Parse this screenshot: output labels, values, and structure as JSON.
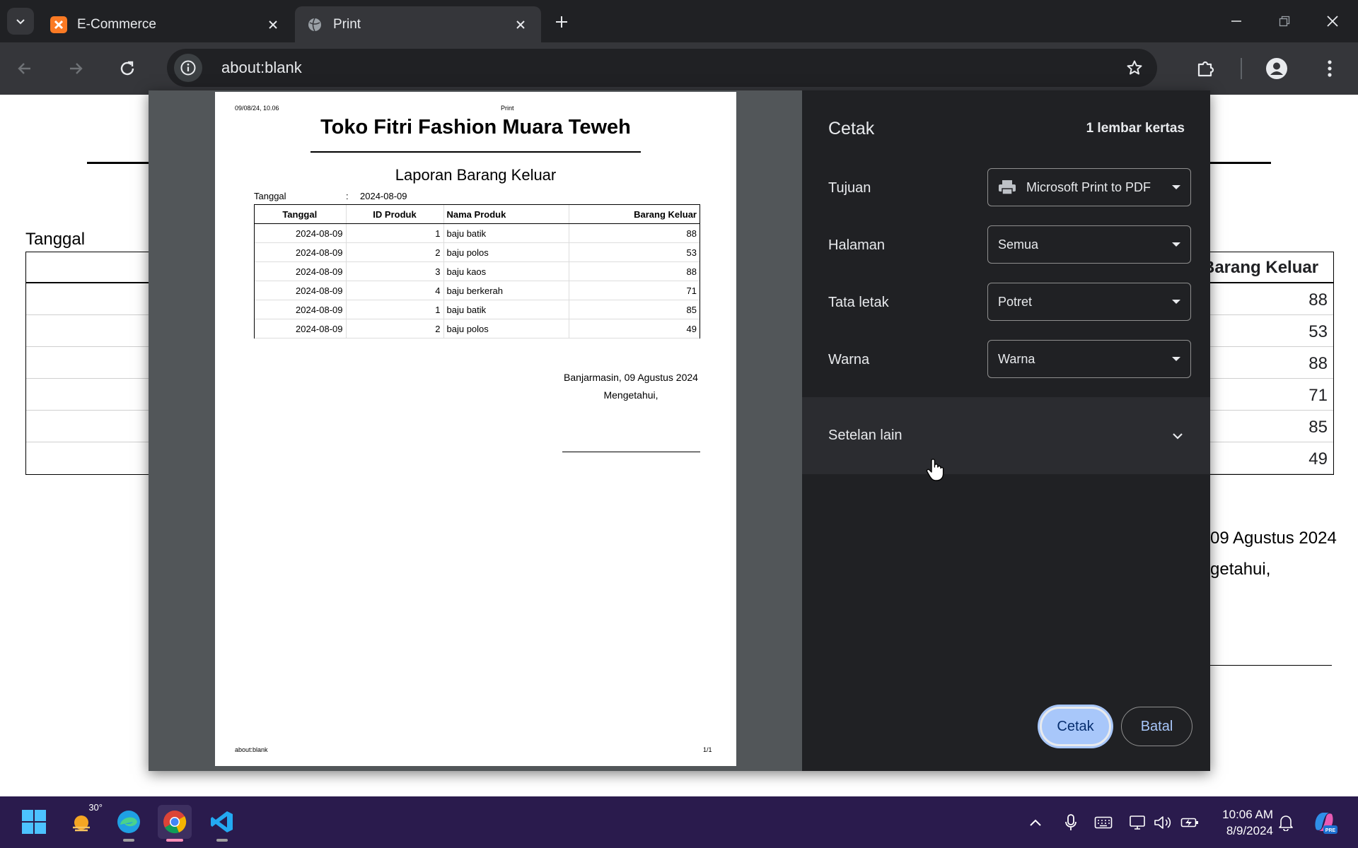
{
  "browser": {
    "tabs": [
      {
        "title": "E-Commerce",
        "active": false,
        "favicon": "xampp-icon"
      },
      {
        "title": "Print",
        "active": true,
        "favicon": "globe-icon"
      }
    ],
    "url": "about:blank"
  },
  "background_page": {
    "tanggal_label": "Tanggal",
    "column_header": "Barang Keluar",
    "values": [
      "88",
      "53",
      "88",
      "71",
      "85",
      "49"
    ],
    "place_date_fragment": "09 Agustus 2024",
    "mengetahui_fragment": "getahui,"
  },
  "preview": {
    "header_left": "09/08/24, 10.06",
    "header_center": "Print",
    "shop_name": "Toko Fitri Fashion Muara Teweh",
    "report_title": "Laporan Barang Keluar",
    "date_label": "Tanggal",
    "date_colon": ":",
    "date_value": "2024-08-09",
    "columns": [
      "Tanggal",
      "ID Produk",
      "Nama Produk",
      "Barang Keluar"
    ],
    "rows": [
      [
        "2024-08-09",
        "1",
        "baju batik",
        "88"
      ],
      [
        "2024-08-09",
        "2",
        "baju polos",
        "53"
      ],
      [
        "2024-08-09",
        "3",
        "baju kaos",
        "88"
      ],
      [
        "2024-08-09",
        "4",
        "baju berkerah",
        "71"
      ],
      [
        "2024-08-09",
        "1",
        "baju batik",
        "85"
      ],
      [
        "2024-08-09",
        "2",
        "baju polos",
        "49"
      ]
    ],
    "place_date": "Banjarmasin, 09 Agustus 2024",
    "mengetahui": "Mengetahui,",
    "footer_left": "about:blank",
    "footer_right": "1/1"
  },
  "print_settings": {
    "title": "Cetak",
    "sheet_count": "1 lembar kertas",
    "destination_label": "Tujuan",
    "destination_value": "Microsoft Print to PDF",
    "pages_label": "Halaman",
    "pages_value": "Semua",
    "layout_label": "Tata letak",
    "layout_value": "Potret",
    "color_label": "Warna",
    "color_value": "Warna",
    "more_settings": "Setelan lain",
    "print_button": "Cetak",
    "cancel_button": "Batal"
  },
  "taskbar": {
    "weather_temp": "30°",
    "time": "10:06 AM",
    "date": "8/9/2024",
    "apps": [
      "windows-start-icon",
      "weather-icon",
      "edge-icon",
      "chrome-icon",
      "vscode-icon"
    ]
  },
  "colors": {
    "accent": "#a8c7fa",
    "dialog_bg": "#202124",
    "taskbar_bg": "#2a1b4d"
  }
}
